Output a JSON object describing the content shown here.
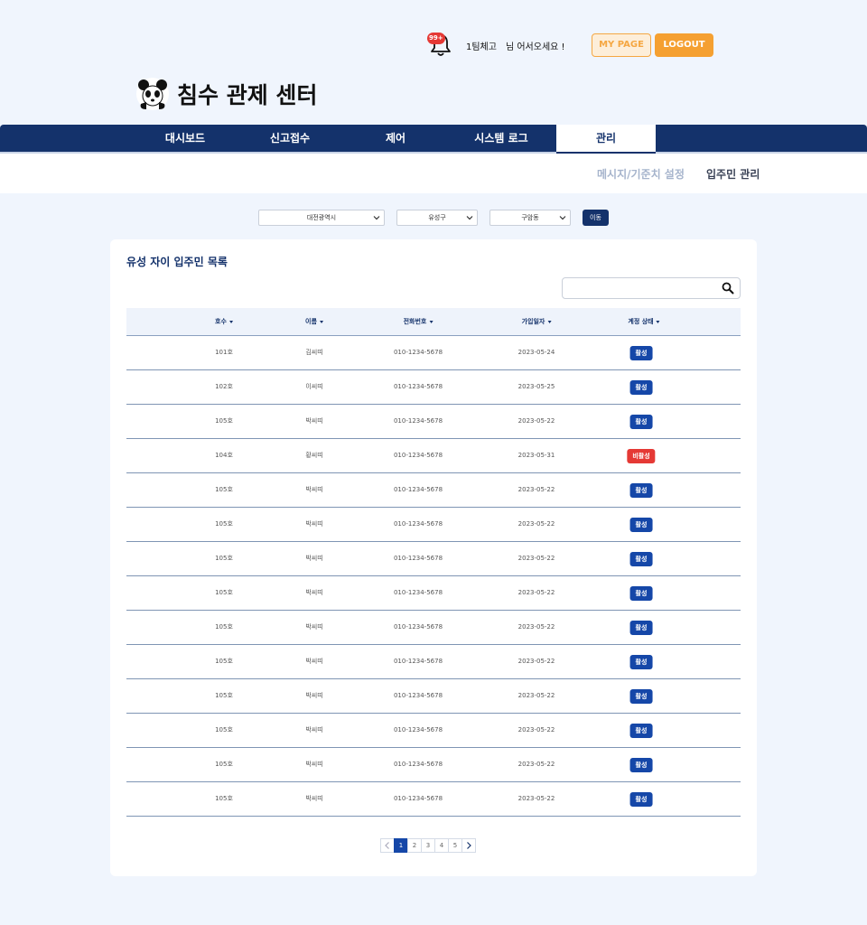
{
  "header": {
    "notification_count": "99+",
    "user_name": "1팀체고",
    "welcome": "님 어서오세요 !",
    "mypage_label": "MY PAGE",
    "logout_label": "LOGOUT",
    "app_title": "침수 관제 센터"
  },
  "nav": {
    "items": [
      {
        "label": "대시보드"
      },
      {
        "label": "신고접수"
      },
      {
        "label": "제어"
      },
      {
        "label": "시스템 로그"
      },
      {
        "label": "관리"
      }
    ],
    "active_index": 4
  },
  "subnav": {
    "items": [
      {
        "label": "메시지/기준치 설정"
      },
      {
        "label": "입주민 관리"
      }
    ],
    "active_index": 1
  },
  "filters": {
    "city": "대전광역시",
    "district": "유성구",
    "dong": "구암동",
    "move_label": "이동"
  },
  "list": {
    "title": "유성 자이 입주민 목록",
    "search_placeholder": "",
    "columns": [
      "호수",
      "이름",
      "전화번호",
      "가입일자",
      "계정 상태"
    ],
    "rows": [
      {
        "unit": "101호",
        "name": "김씨띠",
        "phone": "010-1234-5678",
        "joined": "2023-05-24",
        "status": "활성",
        "active": true
      },
      {
        "unit": "102호",
        "name": "이씨띠",
        "phone": "010-1234-5678",
        "joined": "2023-05-25",
        "status": "활성",
        "active": true
      },
      {
        "unit": "105호",
        "name": "박씨띠",
        "phone": "010-1234-5678",
        "joined": "2023-05-22",
        "status": "활성",
        "active": true
      },
      {
        "unit": "104호",
        "name": "황씨띠",
        "phone": "010-1234-5678",
        "joined": "2023-05-31",
        "status": "비활성",
        "active": false
      },
      {
        "unit": "105호",
        "name": "박씨띠",
        "phone": "010-1234-5678",
        "joined": "2023-05-22",
        "status": "활성",
        "active": true
      },
      {
        "unit": "105호",
        "name": "박씨띠",
        "phone": "010-1234-5678",
        "joined": "2023-05-22",
        "status": "활성",
        "active": true
      },
      {
        "unit": "105호",
        "name": "박씨띠",
        "phone": "010-1234-5678",
        "joined": "2023-05-22",
        "status": "활성",
        "active": true
      },
      {
        "unit": "105호",
        "name": "박씨띠",
        "phone": "010-1234-5678",
        "joined": "2023-05-22",
        "status": "활성",
        "active": true
      },
      {
        "unit": "105호",
        "name": "박씨띠",
        "phone": "010-1234-5678",
        "joined": "2023-05-22",
        "status": "활성",
        "active": true
      },
      {
        "unit": "105호",
        "name": "박씨띠",
        "phone": "010-1234-5678",
        "joined": "2023-05-22",
        "status": "활성",
        "active": true
      },
      {
        "unit": "105호",
        "name": "박씨띠",
        "phone": "010-1234-5678",
        "joined": "2023-05-22",
        "status": "활성",
        "active": true
      },
      {
        "unit": "105호",
        "name": "박씨띠",
        "phone": "010-1234-5678",
        "joined": "2023-05-22",
        "status": "활성",
        "active": true
      },
      {
        "unit": "105호",
        "name": "박씨띠",
        "phone": "010-1234-5678",
        "joined": "2023-05-22",
        "status": "활성",
        "active": true
      },
      {
        "unit": "105호",
        "name": "박씨띠",
        "phone": "010-1234-5678",
        "joined": "2023-05-22",
        "status": "활성",
        "active": true
      }
    ]
  },
  "pagination": {
    "pages": [
      "1",
      "2",
      "3",
      "4",
      "5"
    ],
    "current": "1"
  },
  "colors": {
    "navy": "#14326b",
    "accent_blue": "#1547a8",
    "orange": "#f5a031",
    "inactive_red": "#e53935"
  }
}
